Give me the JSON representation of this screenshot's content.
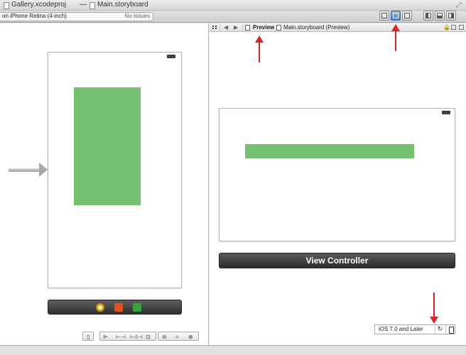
{
  "window": {
    "project_title": "Gallery.xcodeproj",
    "separator": "—",
    "file_title": "Main.storyboard"
  },
  "toolbar": {
    "scheme_text": "on iPhone Retina (4-inch)",
    "issues_text": "No Issues",
    "editor_buttons": [
      "standard-editor",
      "assistant-editor",
      "version-editor"
    ],
    "view_buttons": [
      "navigator",
      "debug-area",
      "utilities"
    ],
    "active_button": "assistant-editor"
  },
  "jump_bar": {
    "preview_label": "Preview",
    "file_label": "Main.storyboard (Preview)"
  },
  "storyboard": {
    "green_color": "#73c06f",
    "scene_dock_icons": [
      "first-responder-icon",
      "view-controller-icon",
      "exit-icon"
    ]
  },
  "preview": {
    "view_controller_label": "View Controller",
    "ios_version_label": "iOS 7.0 and Later"
  },
  "annotations": {
    "arrow_color": "#e22124"
  }
}
